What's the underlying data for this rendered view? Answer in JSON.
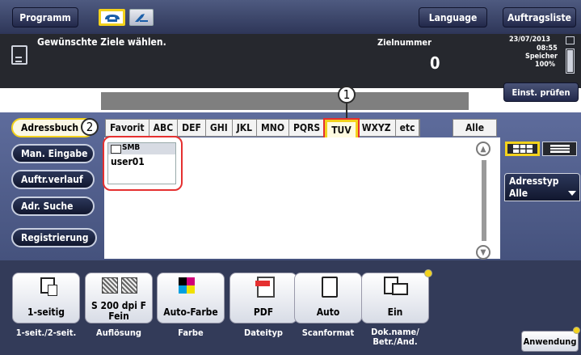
{
  "topbar": {
    "programm_label": "Programm",
    "language_label": "Language",
    "auftragsliste_label": "Auftragsliste"
  },
  "header": {
    "instruction": "Gewünschte Ziele wählen.",
    "zielnummer_label": "Zielnummer",
    "zielnummer_value": "0",
    "date": "23/07/2013",
    "time": "08:55",
    "speicher_label": "Speicher",
    "speicher_value": "100%",
    "einst_pruefen_label": "Einst. prüfen"
  },
  "sidebar": {
    "items": [
      {
        "label": "Adressbuch"
      },
      {
        "label": "Man. Eingabe"
      },
      {
        "label": "Auftr.verlauf"
      },
      {
        "label": "Adr. Suche"
      },
      {
        "label": "Registrierung"
      }
    ]
  },
  "tabs": [
    "Favorit",
    "ABC",
    "DEF",
    "GHI",
    "JKL",
    "MNO",
    "PQRS",
    "TUV",
    "WXYZ",
    "etc"
  ],
  "alle_label": "Alle",
  "selected_tab": "TUV",
  "address_entry": {
    "type": "SMB",
    "name": "user01"
  },
  "adresstyp": {
    "label": "Adresstyp",
    "value": "Alle"
  },
  "markers": {
    "m1": "1",
    "m2": "2"
  },
  "settings": [
    {
      "icon": "duplex-icon",
      "value": "1-seitig",
      "caption": "1-seit./2-seit."
    },
    {
      "icon": "resolution-icon",
      "value": "S 200 dpi F Fein",
      "caption": "Auflösung"
    },
    {
      "icon": "color-icon",
      "value": "Auto-Farbe",
      "caption": "Farbe"
    },
    {
      "icon": "pdf-icon",
      "value": "PDF",
      "caption": "Dateityp"
    },
    {
      "icon": "page-icon",
      "value": "Auto",
      "caption": "Scanformat"
    },
    {
      "icon": "mail-doc-icon",
      "value": "Ein",
      "caption": "Dok.name/ Betr./And."
    }
  ],
  "anwendung_label": "Anwendung",
  "colors": {
    "accent_yellow": "#f3d21c",
    "highlight_red": "#e53030",
    "panel_blue": "#4a5783"
  }
}
